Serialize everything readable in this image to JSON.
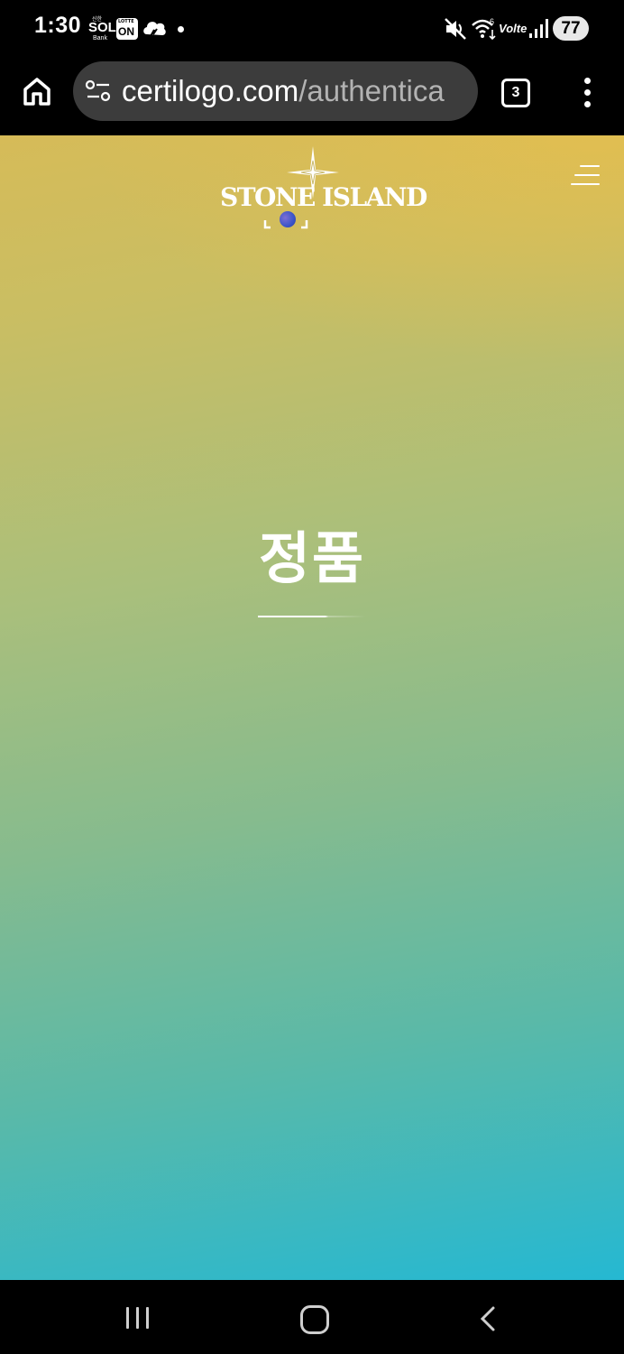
{
  "status_bar": {
    "time": "1:30",
    "apps": {
      "sol_top": "신한",
      "sol_main": "SOL",
      "sol_sub": "Bank",
      "lotte_top": "LOTTE",
      "lotte_main": "ON"
    },
    "network": "Volte",
    "battery": "77",
    "icons": [
      "sol-bank-icon",
      "lotte-on-icon",
      "cloud-icon",
      "notification-dot-icon",
      "mute-icon",
      "wifi-icon",
      "signal-icon",
      "battery-icon"
    ]
  },
  "browser": {
    "url_domain": "certilogo.com",
    "url_path": "/authentica",
    "tab_count": "3",
    "icons": [
      "home-icon",
      "site-settings-icon",
      "more-vert-icon"
    ]
  },
  "page": {
    "brand": "STONE ISLAND",
    "result_title": "정품",
    "colors": {
      "gradient_top": "#d6bb58",
      "gradient_mid": "#86bb8e",
      "gradient_bottom": "#25b8d2",
      "text": "#ffffff"
    }
  },
  "navbar": {
    "icons": [
      "recents-icon",
      "home-circle-icon",
      "back-icon"
    ]
  }
}
